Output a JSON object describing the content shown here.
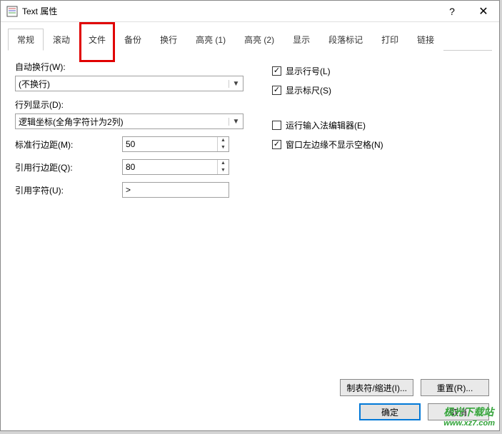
{
  "titlebar": {
    "title": "Text 属性",
    "help": "?",
    "close": "✕"
  },
  "tabs": [
    {
      "label": "常规"
    },
    {
      "label": "滚动"
    },
    {
      "label": "文件"
    },
    {
      "label": "备份"
    },
    {
      "label": "换行"
    },
    {
      "label": "高亮 (1)"
    },
    {
      "label": "高亮 (2)"
    },
    {
      "label": "显示"
    },
    {
      "label": "段落标记"
    },
    {
      "label": "打印"
    },
    {
      "label": "链接"
    }
  ],
  "left": {
    "autowrap_label": "自动换行(W):",
    "autowrap_value": "(不换行)",
    "rowcol_label": "行列显示(D):",
    "rowcol_value": "逻辑坐标(全角字符计为2列)",
    "std_margin_label": "标准行边距(M):",
    "std_margin_value": "50",
    "quote_margin_label": "引用行边距(Q):",
    "quote_margin_value": "80",
    "quote_char_label": "引用字符(U):",
    "quote_char_value": ">"
  },
  "right": {
    "show_linenum": "显示行号(L)",
    "show_ruler": "显示标尺(S)",
    "run_ime": "运行输入法编辑器(E)",
    "left_edge_blank": "窗口左边缘不显示空格(N)"
  },
  "footer": {
    "tabs_indent": "制表符/缩进(I)...",
    "reset": "重置(R)...",
    "ok": "确定",
    "cancel": "取消"
  },
  "watermark": {
    "line1": "极光下载站",
    "line2": "www.xz7.com"
  }
}
